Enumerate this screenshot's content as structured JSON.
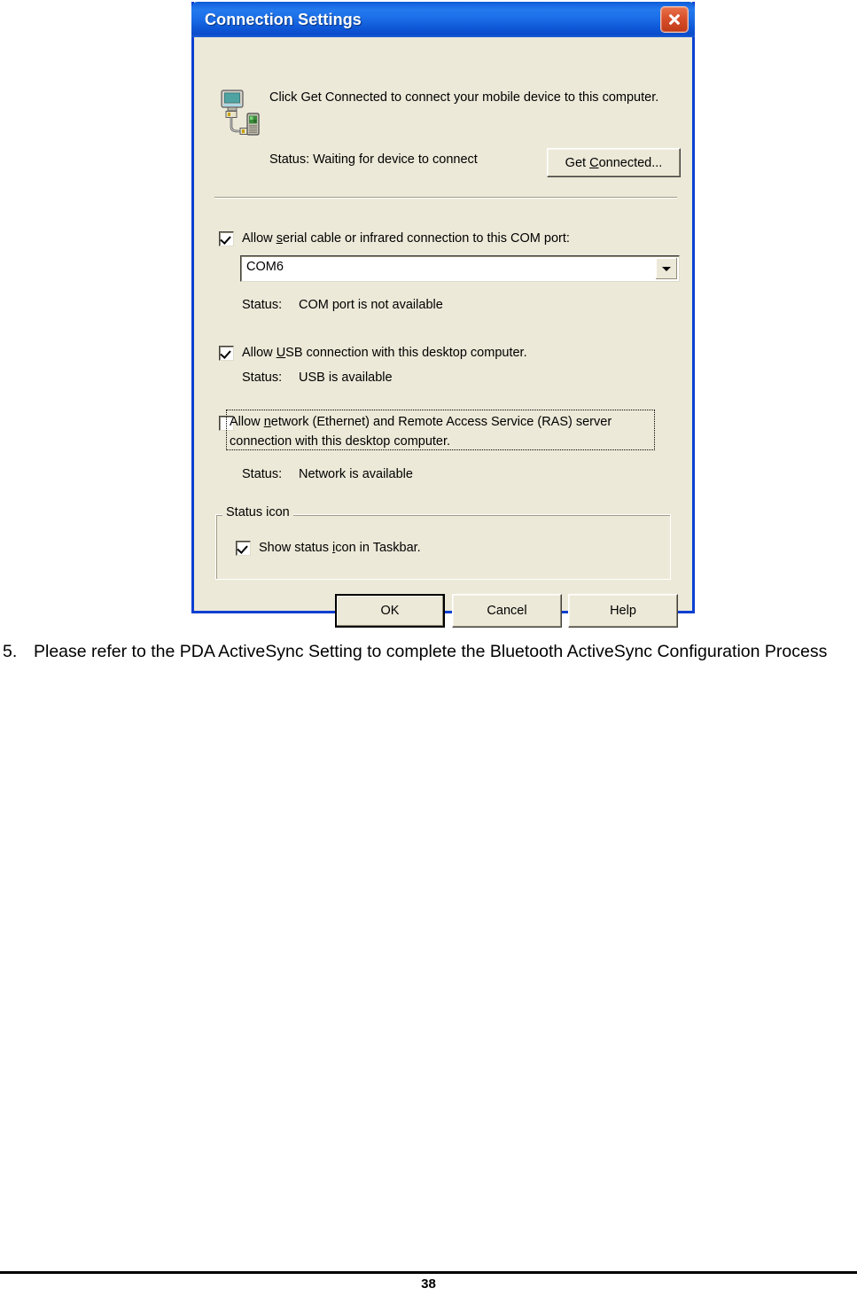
{
  "dialog": {
    "title": "Connection Settings",
    "close_label": "Close",
    "intro_text": "Click Get Connected to connect your mobile device to this computer.",
    "connection_status": "Status: Waiting for device to connect",
    "get_connected_button": "Get Connected...",
    "serial": {
      "label_before": "Allow ",
      "accel": "s",
      "label_after": "erial cable or infrared connection to this COM port:",
      "checked": true,
      "com_port_value": "COM6",
      "status_label": "Status:",
      "status_value": "COM port is not available"
    },
    "usb": {
      "label_before": "Allow ",
      "accel": "U",
      "label_after": "SB connection with this desktop computer.",
      "checked": true,
      "status_label": "Status:",
      "status_value": "USB is available"
    },
    "network": {
      "label_before": "Allow ",
      "accel": "n",
      "label_after": "etwork (Ethernet) and Remote Access Service (RAS) server connection with this desktop computer.",
      "checked": false,
      "status_label": "Status:",
      "status_value": "Network is available"
    },
    "status_icon_group": {
      "title": "Status icon",
      "checkbox_before": "Show status ",
      "checkbox_accel": "i",
      "checkbox_after": "con in Taskbar.",
      "checked": true
    },
    "buttons": {
      "ok": "OK",
      "cancel": "Cancel",
      "help": "Help"
    },
    "colors": {
      "dialog_face": "#ECE9D8",
      "titlebar_blue": "#1767E2",
      "titlebar_border": "#0A3FD1",
      "close_red": "#D8502A",
      "text": "#000000"
    }
  },
  "page": {
    "step_number": "5.",
    "step_text": "Please refer to the PDA ActiveSync Setting to complete the Bluetooth ActiveSync Configuration Process",
    "page_number": "38"
  }
}
